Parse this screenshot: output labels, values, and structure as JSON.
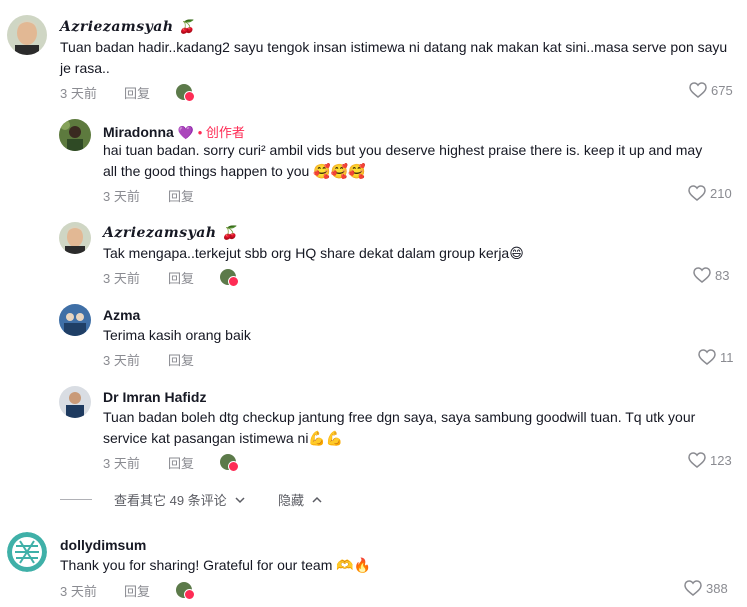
{
  "comments": [
    {
      "name": "Azriezamsyah",
      "badge": "🍒",
      "text": "Tuan badan hadir..kadang2 sayu tengok insan istimewa ni datang nak makan kat sini..masa serve pon sayu je rasa..",
      "time": "3 天前",
      "reply": "回复",
      "likes": "675"
    },
    {
      "name": "Miradonna",
      "badge": "💜",
      "creator_label": "创作者",
      "text": "hai tuan badan. sorry curi² ambil vids but you deserve highest praise there is. keep it up and may all the good things happen to you 🥰🥰🥰",
      "time": "3 天前",
      "reply": "回复",
      "likes": "210"
    },
    {
      "name": "Azriezamsyah",
      "badge": "🍒",
      "text": "Tak mengapa..terkejut sbb org HQ share dekat dalam group kerja😄",
      "time": "3 天前",
      "reply": "回复",
      "likes": "83"
    },
    {
      "name": "Azma",
      "text": "Terima kasih orang baik",
      "time": "3 天前",
      "reply": "回复",
      "likes": "11"
    },
    {
      "name": "Dr Imran Hafidz",
      "text": "Tuan badan boleh dtg checkup jantung free dgn saya, saya sambung goodwill tuan. Tq utk your service kat pasangan istimewa ni💪💪",
      "time": "3 天前",
      "reply": "回复",
      "likes": "123"
    },
    {
      "name": "dollydimsum",
      "text": "Thank you for sharing! Grateful for our team 🫶🔥",
      "time": "3 天前",
      "reply": "回复",
      "likes": "388"
    }
  ],
  "view_more": "查看其它 49 条评论",
  "hide": "隐藏",
  "colors": {
    "accent": "#fe2c55",
    "muted": "#8a8b91"
  }
}
